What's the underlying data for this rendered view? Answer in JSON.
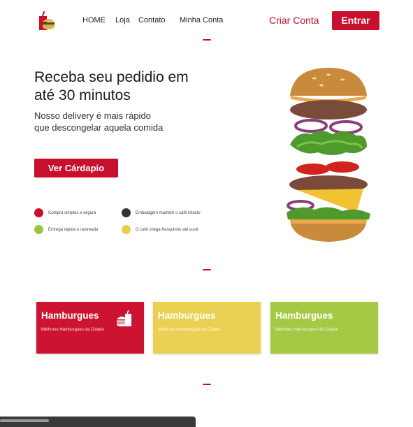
{
  "header": {
    "logo_icon": "burger-logo-icon",
    "nav": [
      "HOME",
      "Loja",
      "Contato",
      "Minha Conta"
    ],
    "criar_conta": "Criar Conta",
    "entrar": "Entrar"
  },
  "hero": {
    "title": "Receba seu pedidio em até 30 minutos",
    "subtitle": "Nosso delivery é mais rápido que descongelar aquela comida",
    "cta": "Ver Cárdapio",
    "image_icon": "burger-image"
  },
  "features": [
    {
      "text": "Compra simples e segura",
      "icon": "cart-icon",
      "color": "#c8102e"
    },
    {
      "text": "Embalagem mantém o café intacto",
      "icon": "package-icon",
      "color": "#333333"
    },
    {
      "text": "Entrega rápida e rastreada",
      "icon": "delivery-icon",
      "color": "#9dc440"
    },
    {
      "text": "O café chega fresquinho até você",
      "icon": "coffee-icon",
      "color": "#e7cf48"
    }
  ],
  "cards": [
    {
      "title": "Hamburgues",
      "desc": "Melhores Hamburgues da Cidade",
      "color": "#cc1432",
      "icon": "burger-drink-icon"
    },
    {
      "title": "Hamburgues",
      "desc": "Melhores Hamburgues da Cidade",
      "color": "#ebd153"
    },
    {
      "title": "Hamburgues",
      "desc": "Melhores Hamburgues da Cidade",
      "color": "#a5c944"
    }
  ],
  "colors": {
    "accent": "#c8102e"
  }
}
